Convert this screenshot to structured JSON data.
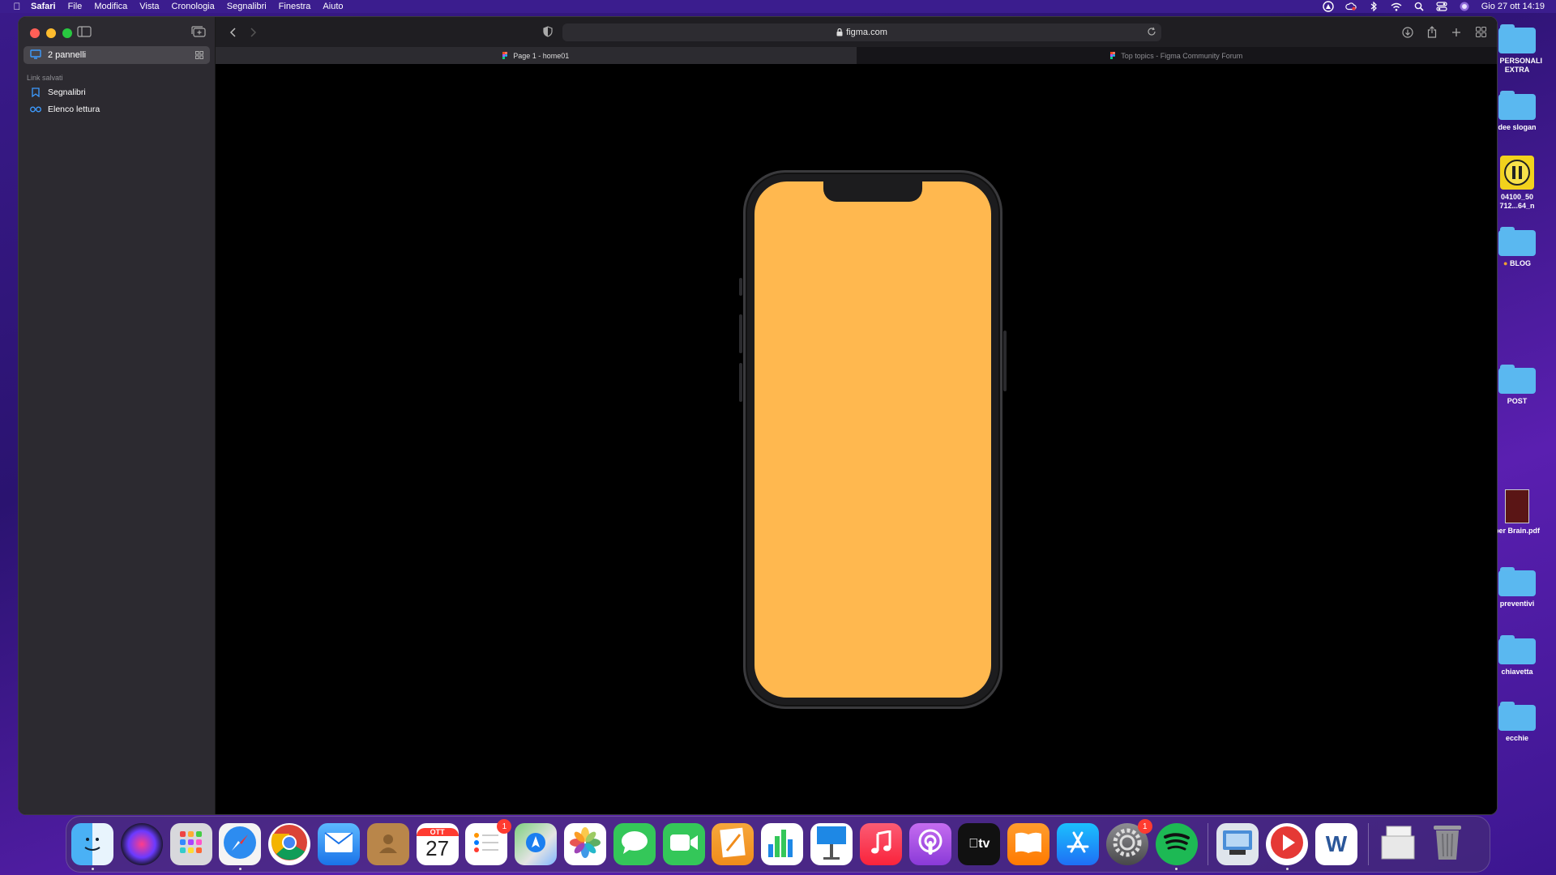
{
  "menubar": {
    "app_name": "Safari",
    "items": [
      "File",
      "Modifica",
      "Vista",
      "Cronologia",
      "Segnalibri",
      "Finestra",
      "Aiuto"
    ],
    "clock": "Gio 27 ott  14:19"
  },
  "sidebar": {
    "tab_group_label": "2 pannelli",
    "section_title": "Link salvati",
    "links": [
      {
        "label": "Segnalibri",
        "icon": "bookmark-icon"
      },
      {
        "label": "Elenco lettura",
        "icon": "reading-list-icon"
      }
    ]
  },
  "toolbar": {
    "url": "figma.com"
  },
  "tabs": [
    {
      "title": "Page 1 - home01",
      "active": true
    },
    {
      "title": "Top topics - Figma Community Forum",
      "active": false
    }
  ],
  "canvas": {
    "phone_screen_color": "#ffb84f"
  },
  "desktop": {
    "items": [
      {
        "label": "O PERSONALI EXTRA",
        "type": "folder"
      },
      {
        "label": "dee slogan",
        "type": "folder"
      },
      {
        "label": "04100_50 712...64_n",
        "type": "image"
      },
      {
        "label": "BLOG",
        "type": "folder"
      },
      {
        "label": "POST",
        "type": "folder"
      },
      {
        "label": "per Brain.pdf",
        "type": "pdf"
      },
      {
        "label": "preventivi",
        "type": "folder"
      },
      {
        "label": "chiavetta",
        "type": "folder"
      },
      {
        "label": "ecchie",
        "type": "folder"
      }
    ]
  },
  "dock": {
    "apps": [
      {
        "name": "Finder",
        "icon": "finder-icon"
      },
      {
        "name": "Siri",
        "icon": "siri-icon"
      },
      {
        "name": "Launchpad",
        "icon": "launchpad-icon"
      },
      {
        "name": "Safari",
        "icon": "safari-icon"
      },
      {
        "name": "Chrome",
        "icon": "chrome-icon"
      },
      {
        "name": "Mail",
        "icon": "mail-icon"
      },
      {
        "name": "Contatti",
        "icon": "contacts-icon"
      },
      {
        "name": "Calendario",
        "icon": "calendar-icon",
        "month": "OTT",
        "day": "27"
      },
      {
        "name": "Promemoria",
        "icon": "reminders-icon",
        "badge": "1"
      },
      {
        "name": "Mappe",
        "icon": "maps-icon"
      },
      {
        "name": "Foto",
        "icon": "photos-icon"
      },
      {
        "name": "Messaggi",
        "icon": "messages-icon"
      },
      {
        "name": "FaceTime",
        "icon": "facetime-icon"
      },
      {
        "name": "Pages",
        "icon": "pages-icon"
      },
      {
        "name": "Numbers",
        "icon": "numbers-icon"
      },
      {
        "name": "Keynote",
        "icon": "keynote-icon"
      },
      {
        "name": "Musica",
        "icon": "music-icon"
      },
      {
        "name": "Podcast",
        "icon": "podcasts-icon"
      },
      {
        "name": "TV",
        "icon": "appletv-icon",
        "label": "tv"
      },
      {
        "name": "Libri",
        "icon": "books-icon"
      },
      {
        "name": "App Store",
        "icon": "appstore-icon"
      },
      {
        "name": "Impostazioni di Sistema",
        "icon": "settings-icon",
        "badge": "1"
      },
      {
        "name": "Spotify",
        "icon": "spotify-icon"
      },
      {
        "name": "Anteprima",
        "icon": "preview-icon"
      },
      {
        "name": "Player",
        "icon": "play-icon"
      },
      {
        "name": "Word",
        "icon": "word-icon",
        "label": "W"
      },
      {
        "name": "Documenti",
        "icon": "documents-icon"
      },
      {
        "name": "Cestino",
        "icon": "trash-icon"
      }
    ]
  }
}
